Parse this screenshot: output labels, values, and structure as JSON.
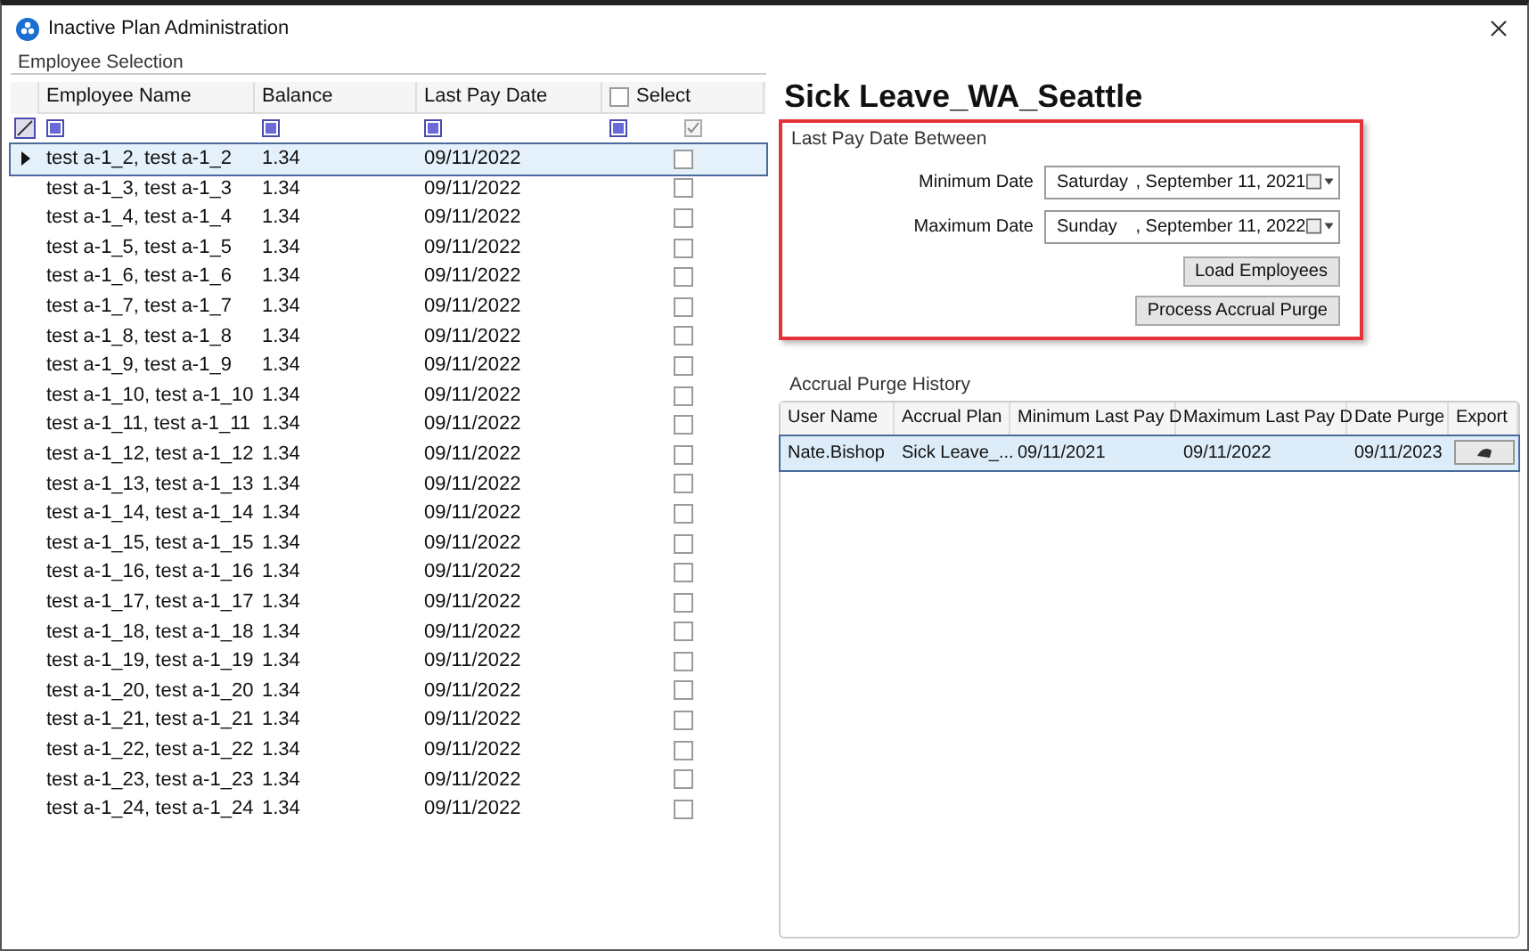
{
  "window": {
    "title": "Inactive Plan Administration"
  },
  "employee_selection": {
    "title": "Employee Selection",
    "columns": [
      "Employee Name",
      "Balance",
      "Last Pay Date",
      "Select"
    ],
    "select_all_checked": false,
    "rows": [
      {
        "name": "test a-1_2, test a-1_2",
        "balance": "1.34",
        "last_pay_date": "09/11/2022",
        "checked": false,
        "selected": true
      },
      {
        "name": "test a-1_3, test a-1_3",
        "balance": "1.34",
        "last_pay_date": "09/11/2022",
        "checked": false,
        "selected": false
      },
      {
        "name": "test a-1_4, test a-1_4",
        "balance": "1.34",
        "last_pay_date": "09/11/2022",
        "checked": false,
        "selected": false
      },
      {
        "name": "test a-1_5, test a-1_5",
        "balance": "1.34",
        "last_pay_date": "09/11/2022",
        "checked": false,
        "selected": false
      },
      {
        "name": "test a-1_6, test a-1_6",
        "balance": "1.34",
        "last_pay_date": "09/11/2022",
        "checked": false,
        "selected": false
      },
      {
        "name": "test a-1_7, test a-1_7",
        "balance": "1.34",
        "last_pay_date": "09/11/2022",
        "checked": false,
        "selected": false
      },
      {
        "name": "test a-1_8, test a-1_8",
        "balance": "1.34",
        "last_pay_date": "09/11/2022",
        "checked": false,
        "selected": false
      },
      {
        "name": "test a-1_9, test a-1_9",
        "balance": "1.34",
        "last_pay_date": "09/11/2022",
        "checked": false,
        "selected": false
      },
      {
        "name": "test a-1_10, test a-1_10",
        "balance": "1.34",
        "last_pay_date": "09/11/2022",
        "checked": false,
        "selected": false
      },
      {
        "name": "test a-1_11, test a-1_11",
        "balance": "1.34",
        "last_pay_date": "09/11/2022",
        "checked": false,
        "selected": false
      },
      {
        "name": "test a-1_12, test a-1_12",
        "balance": "1.34",
        "last_pay_date": "09/11/2022",
        "checked": false,
        "selected": false
      },
      {
        "name": "test a-1_13, test a-1_13",
        "balance": "1.34",
        "last_pay_date": "09/11/2022",
        "checked": false,
        "selected": false
      },
      {
        "name": "test a-1_14, test a-1_14",
        "balance": "1.34",
        "last_pay_date": "09/11/2022",
        "checked": false,
        "selected": false
      },
      {
        "name": "test a-1_15, test a-1_15",
        "balance": "1.34",
        "last_pay_date": "09/11/2022",
        "checked": false,
        "selected": false
      },
      {
        "name": "test a-1_16, test a-1_16",
        "balance": "1.34",
        "last_pay_date": "09/11/2022",
        "checked": false,
        "selected": false
      },
      {
        "name": "test a-1_17, test a-1_17",
        "balance": "1.34",
        "last_pay_date": "09/11/2022",
        "checked": false,
        "selected": false
      },
      {
        "name": "test a-1_18, test a-1_18",
        "balance": "1.34",
        "last_pay_date": "09/11/2022",
        "checked": false,
        "selected": false
      },
      {
        "name": "test a-1_19, test a-1_19",
        "balance": "1.34",
        "last_pay_date": "09/11/2022",
        "checked": false,
        "selected": false
      },
      {
        "name": "test a-1_20, test a-1_20",
        "balance": "1.34",
        "last_pay_date": "09/11/2022",
        "checked": false,
        "selected": false
      },
      {
        "name": "test a-1_21, test a-1_21",
        "balance": "1.34",
        "last_pay_date": "09/11/2022",
        "checked": false,
        "selected": false
      },
      {
        "name": "test a-1_22, test a-1_22",
        "balance": "1.34",
        "last_pay_date": "09/11/2022",
        "checked": false,
        "selected": false
      },
      {
        "name": "test a-1_23, test a-1_23",
        "balance": "1.34",
        "last_pay_date": "09/11/2022",
        "checked": false,
        "selected": false
      },
      {
        "name": "test a-1_24, test a-1_24",
        "balance": "1.34",
        "last_pay_date": "09/11/2022",
        "checked": false,
        "selected": false
      }
    ]
  },
  "plan_title": "Sick Leave_WA_Seattle",
  "date_range": {
    "title": "Last Pay Date Between",
    "fields": [
      {
        "label": "Minimum Date",
        "day": "Saturday",
        "date": ", September 11, 2021"
      },
      {
        "label": "Maximum Date",
        "day": "Sunday",
        "date": ", September 11, 2022"
      }
    ],
    "buttons": [
      "Load Employees",
      "Process Accrual Purge"
    ]
  },
  "history": {
    "title": "Accrual Purge History",
    "columns": [
      "User Name",
      "Accrual Plan",
      "Minimum Last Pay D",
      "Maximum Last Pay D",
      "Date Purge",
      "Export"
    ],
    "rows": [
      {
        "cells": [
          "Nate.Bishop",
          "Sick Leave_...",
          "09/11/2021",
          "09/11/2022",
          "09/11/2023"
        ],
        "selected": true
      }
    ]
  }
}
